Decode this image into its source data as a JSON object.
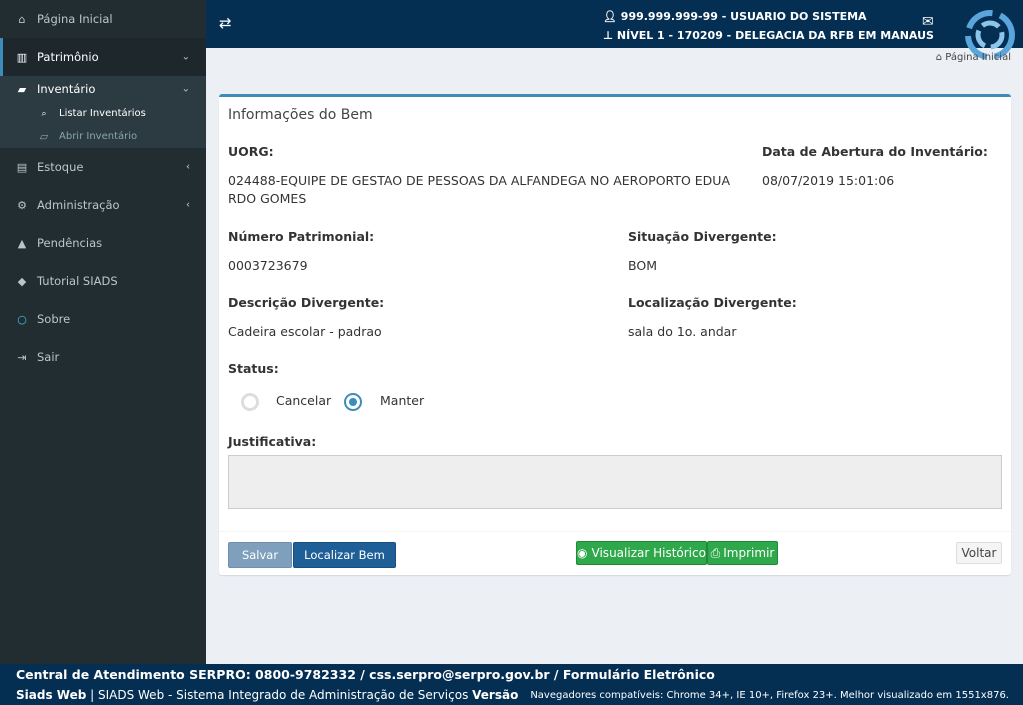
{
  "sidebar": {
    "items": [
      {
        "icon": "home-icon",
        "glyph": "⌂",
        "label": "Página Inicial"
      },
      {
        "icon": "barcode-icon",
        "glyph": "▥",
        "label": "Patrimônio",
        "arrow": "⌄"
      },
      {
        "icon": "book-icon",
        "glyph": "▰",
        "label": "Inventário",
        "arrow": "⌄"
      },
      {
        "icon": "search-icon",
        "glyph": "🔍",
        "label": "Listar Inventários"
      },
      {
        "icon": "folder-open-icon",
        "glyph": "▱",
        "label": "Abrir Inventário"
      },
      {
        "icon": "archive-icon",
        "glyph": "▤",
        "label": "Estoque",
        "arrow": "‹"
      },
      {
        "icon": "cogs-icon",
        "glyph": "⚙",
        "label": "Administração",
        "arrow": "‹"
      },
      {
        "icon": "warning-icon",
        "glyph": "▲",
        "label": "Pendências"
      },
      {
        "icon": "graduation-cap-icon",
        "glyph": "◆",
        "label": "Tutorial SIADS"
      },
      {
        "icon": "circle-icon",
        "glyph": "○",
        "label": "Sobre"
      },
      {
        "icon": "sign-out-icon",
        "glyph": "⇥",
        "label": "Sair"
      }
    ]
  },
  "header": {
    "toggle_glyph": "⇄",
    "user": "999.999.999-99 - USUARIO DO SISTEMA",
    "level": "NÍVEL 1 - 170209 - DELEGACIA DA RFB EM MANAUS",
    "mail_glyph": "✉"
  },
  "breadcrumb": "Página Inicial",
  "box": {
    "title": "Informações do Bem",
    "uorg_label": "UORG:",
    "uorg_value": "024488-EQUIPE DE GESTAO DE PESSOAS DA ALFANDEGA NO AEROPORTO EDUA RDO GOMES",
    "data_label": "Data de Abertura do Inventário:",
    "data_value": "08/07/2019 15:01:06",
    "numero_label": "Número Patrimonial:",
    "numero_value": "0003723679",
    "situacao_label": "Situação Divergente:",
    "situacao_value": "BOM",
    "descricao_label": "Descrição Divergente:",
    "descricao_value": "Cadeira escolar - padrao",
    "localizacao_label": "Localização Divergente:",
    "localizacao_value": "sala do 1o. andar",
    "status_label": "Status:",
    "status_options": [
      "Cancelar",
      "Manter"
    ],
    "status_selected": "Manter",
    "justificativa_label": "Justificativa:",
    "justificativa_value": ""
  },
  "buttons": {
    "salvar": "Salvar",
    "localizar": "Localizar Bem",
    "historico": "Visualizar Histórico",
    "imprimir": "Imprimir",
    "voltar": "Voltar"
  },
  "footer": {
    "line1": "Central de Atendimento SERPRO: 0800-9782332 / css.serpro@serpro.gov.br / Formulário Eletrônico",
    "app_name": "Siads Web",
    "app_desc": " | SIADS Web - Sistema Integrado de Administração de Serviços  ",
    "version_label": "Versão",
    "browsers": "Navegadores compatíveis: Chrome 34+, IE 10+, Firefox 23+. Melhor visualizado em 1551x876."
  },
  "colors": {
    "sidebar_bg": "#222d32",
    "header_bg": "#042f53",
    "accent": "#3c8dbc",
    "success": "#2ea84a"
  }
}
